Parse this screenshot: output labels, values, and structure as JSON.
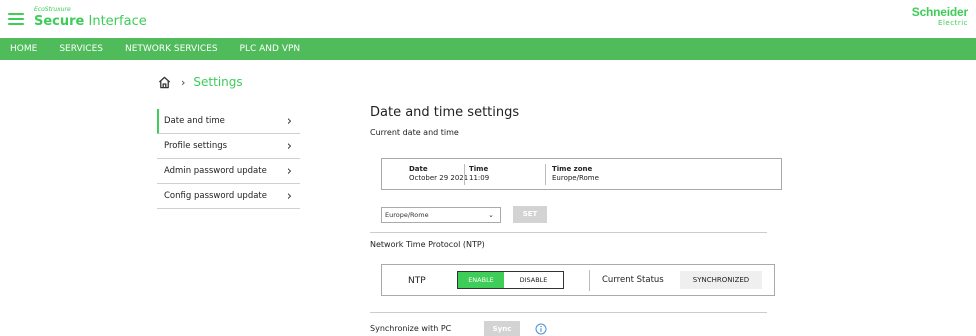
{
  "header": {
    "brand_eco": "EcoStruxure",
    "brand_secure": "Secure",
    "brand_interface": "Interface",
    "logo_line1": "Schneider",
    "logo_line2": "Electric",
    "icons": [
      "menu-icon",
      "home-icon",
      "chevron-right-icon",
      "info-icon"
    ]
  },
  "nav": {
    "items": [
      "HOME",
      "SERVICES",
      "NETWORK SERVICES",
      "PLC AND VPN"
    ]
  },
  "breadcrumb": {
    "separator": "›",
    "current": "Settings"
  },
  "sidebar": {
    "items": [
      {
        "label": "Date and time"
      },
      {
        "label": "Profile settings"
      },
      {
        "label": "Admin password update"
      },
      {
        "label": "Config password update"
      }
    ],
    "chevron": "›"
  },
  "main": {
    "title": "Date and time settings",
    "current_label": "Current date and time",
    "date_header": "Date",
    "date_value": "October 29 2021",
    "time_header": "Time",
    "time_value": "11:09",
    "tz_header": "Time zone",
    "tz_value": "Europe/Rome",
    "tz_select_value": "Europe/Rome",
    "set_label": "SET",
    "ntp_section": "Network Time Protocol (NTP)",
    "ntp_label": "NTP",
    "enable_label": "ENABLE",
    "disable_label": "DISABLE",
    "status_label": "Current Status",
    "status_value": "SYNCHRONIZED",
    "sync_label": "Synchronize with PC",
    "sync_button": "Sync"
  },
  "colors": {
    "accent": "#3dcd58",
    "navbar": "#4fbb5a",
    "disabled_button": "#d3d3d3"
  }
}
